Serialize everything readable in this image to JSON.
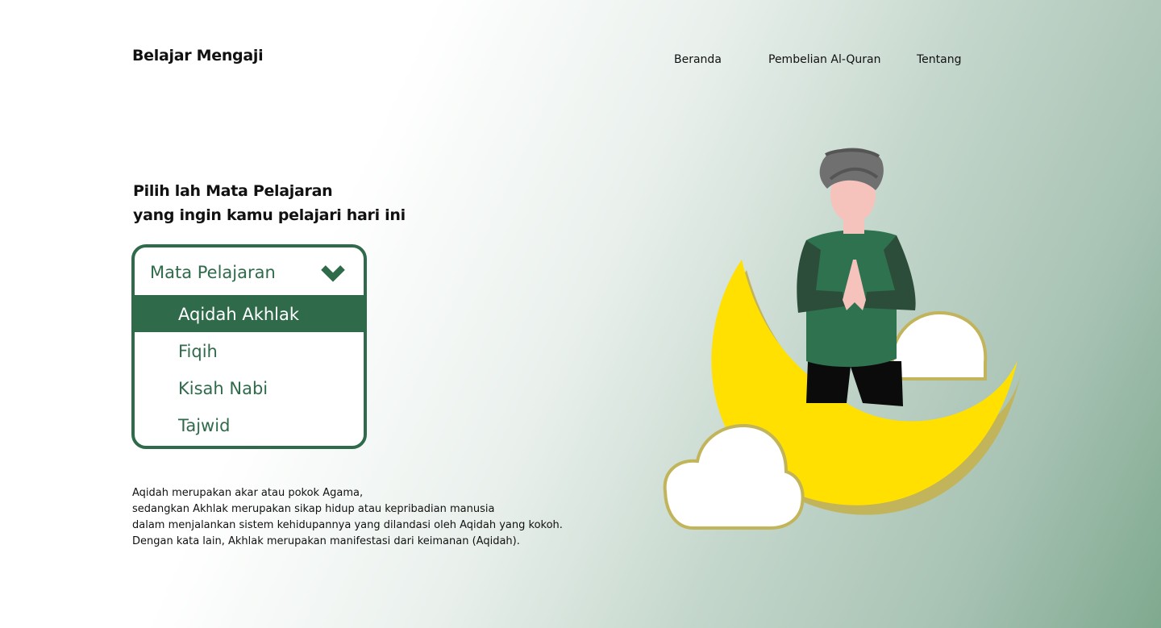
{
  "header": {
    "brand": "Belajar Mengaji",
    "nav": [
      "Beranda",
      "Pembelian Al-Quran",
      "Tentang"
    ]
  },
  "main": {
    "headline_line1": "Pilih lah Mata Pelajaran",
    "headline_line2": "yang ingin kamu pelajari hari ini",
    "dropdown": {
      "label": "Mata Pelajaran",
      "icon": "chevron-down-icon",
      "options": [
        "Aqidah Akhlak",
        "Fiqih",
        "Kisah Nabi",
        "Tajwid"
      ],
      "selected": "Aqidah Akhlak"
    },
    "description": [
      "Aqidah merupakan akar atau pokok Agama,",
      "sedangkan Akhlak merupakan sikap hidup atau kepribadian manusia",
      "dalam menjalankan sistem kehidupannya yang dilandasi oleh Aqidah yang kokoh.",
      "Dengan kata lain, Akhlak merupakan manifestasi dari keimanan (Aqidah)."
    ]
  },
  "colors": {
    "primary_green": "#2f6b4a",
    "moon_yellow": "#ffe000",
    "moon_shadow": "#c2b45a"
  }
}
